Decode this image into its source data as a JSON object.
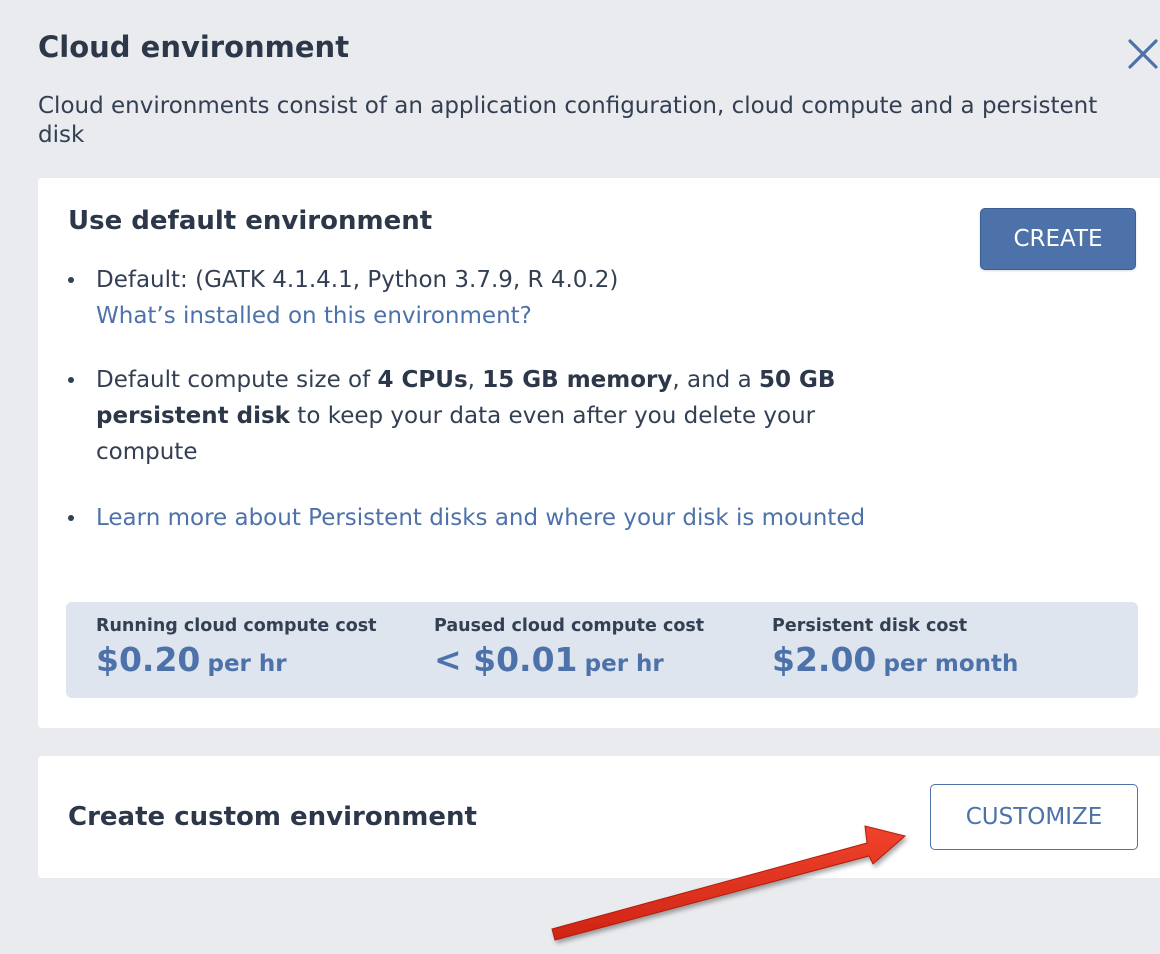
{
  "header": {
    "title": "Cloud environment",
    "subtitle": "Cloud environments consist of an application configuration, cloud compute and a persistent disk",
    "close_icon": "close-x-icon"
  },
  "default_env": {
    "title": "Use default environment",
    "create_label": "CREATE",
    "bullet1": {
      "text": "Default: (GATK 4.1.4.1, Python 3.7.9, R 4.0.2)",
      "link": "What’s installed on this environment?"
    },
    "bullet2": {
      "part1": "Default compute size of ",
      "cpus": "4 CPUs",
      "sep1": ", ",
      "memory": "15 GB memory",
      "part2": ", and a ",
      "disk": "50 GB persistent disk",
      "part3": " to keep your data even after you delete your compute"
    },
    "bullet3": {
      "link": "Learn more about Persistent disks and where your disk is mounted"
    },
    "costs": [
      {
        "label": "Running cloud compute cost",
        "value": "$0.20",
        "unit": "per hr"
      },
      {
        "label": "Paused cloud compute cost",
        "value": "< $0.01",
        "unit": "per hr"
      },
      {
        "label": "Persistent disk cost",
        "value": "$2.00",
        "unit": "per month"
      }
    ]
  },
  "custom_env": {
    "title": "Create custom environment",
    "customize_label": "CUSTOMIZE"
  },
  "annotation": {
    "icon": "red-arrow-icon",
    "color": "#e0301e"
  },
  "colors": {
    "accent": "#4d72aa",
    "background": "#e9ebee",
    "cost_box": "#dfe5ef",
    "heading": "#2c3849"
  }
}
